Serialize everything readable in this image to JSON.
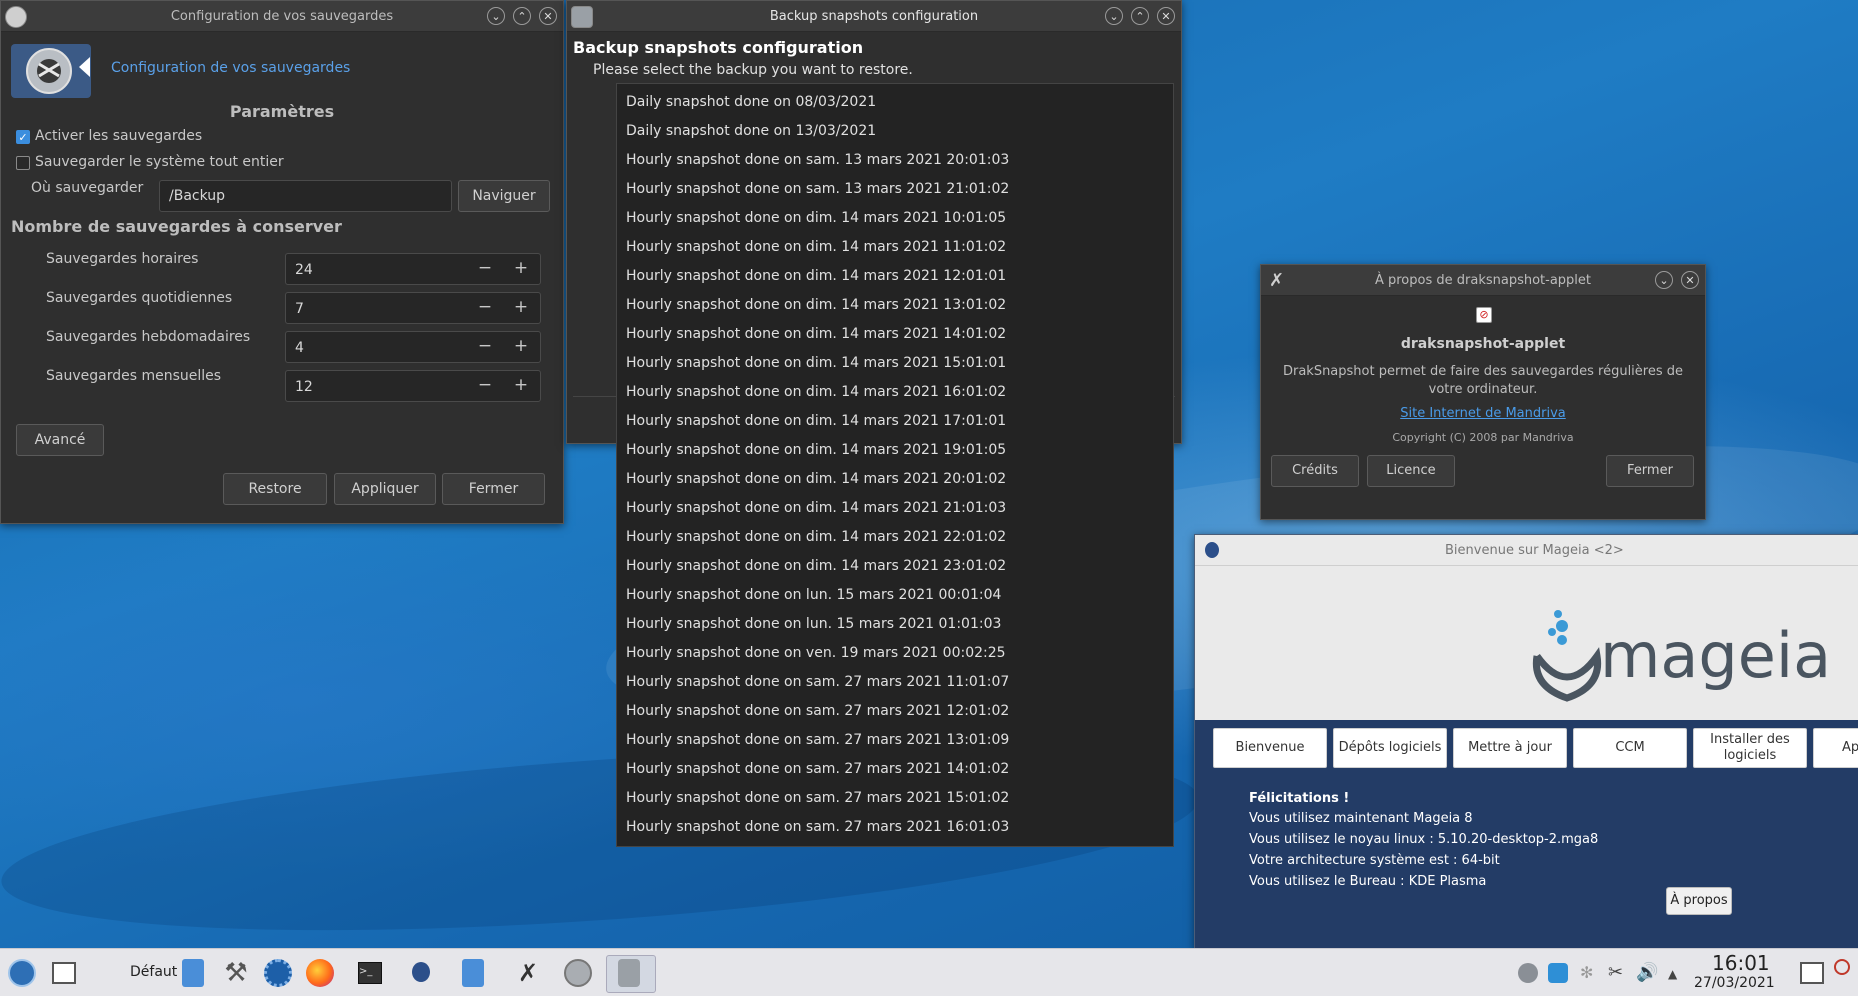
{
  "window_config": {
    "title": "Configuration de vos sauvegardes",
    "header_link": "Configuration de vos sauvegardes",
    "section_params": "Paramètres",
    "enable_label": "Activer les sauvegardes",
    "enable_checked": true,
    "whole_system_label": "Sauvegarder le système tout entier",
    "whole_system_checked": false,
    "where_label": "Où sauvegarder",
    "where_value": "/Backup",
    "browse_label": "Naviguer",
    "section_count": "Nombre de sauvegardes à conserver",
    "spinners": [
      {
        "label": "Sauvegardes horaires",
        "value": "24"
      },
      {
        "label": "Sauvegardes quotidiennes",
        "value": "7"
      },
      {
        "label": "Sauvegardes hebdomadaires",
        "value": "4"
      },
      {
        "label": "Sauvegardes mensuelles",
        "value": "12"
      }
    ],
    "advanced_label": "Avancé",
    "restore_label": "Restore",
    "apply_label": "Appliquer",
    "close_label": "Fermer"
  },
  "window_snapshots": {
    "title": "Backup snapshots configuration",
    "heading": "Backup snapshots configuration",
    "instruction": "Please select the backup you want to restore.",
    "items": [
      "Daily snapshot done on 08/03/2021",
      "Daily snapshot done on 13/03/2021",
      "Hourly snapshot done on sam. 13 mars 2021 20:01:03",
      "Hourly snapshot done on sam. 13 mars 2021 21:01:02",
      "Hourly snapshot done on dim. 14 mars 2021 10:01:05",
      "Hourly snapshot done on dim. 14 mars 2021 11:01:02",
      "Hourly snapshot done on dim. 14 mars 2021 12:01:01",
      "Hourly snapshot done on dim. 14 mars 2021 13:01:02",
      "Hourly snapshot done on dim. 14 mars 2021 14:01:02",
      "Hourly snapshot done on dim. 14 mars 2021 15:01:01",
      "Hourly snapshot done on dim. 14 mars 2021 16:01:02",
      "Hourly snapshot done on dim. 14 mars 2021 17:01:01",
      "Hourly snapshot done on dim. 14 mars 2021 19:01:05",
      "Hourly snapshot done on dim. 14 mars 2021 20:01:02",
      "Hourly snapshot done on dim. 14 mars 2021 21:01:03",
      "Hourly snapshot done on dim. 14 mars 2021 22:01:02",
      "Hourly snapshot done on dim. 14 mars 2021 23:01:02",
      "Hourly snapshot done on lun. 15 mars 2021 00:01:04",
      "Hourly snapshot done on lun. 15 mars 2021 01:01:03",
      "Hourly snapshot done on ven. 19 mars 2021 00:02:25",
      "Hourly snapshot done on sam. 27 mars 2021 11:01:07",
      "Hourly snapshot done on sam. 27 mars 2021 12:01:02",
      "Hourly snapshot done on sam. 27 mars 2021 13:01:09",
      "Hourly snapshot done on sam. 27 mars 2021 14:01:02",
      "Hourly snapshot done on sam. 27 mars 2021 15:01:02",
      "Hourly snapshot done on sam. 27 mars 2021 16:01:03"
    ]
  },
  "window_about": {
    "title": "À propos de draksnapshot-applet",
    "app_name": "draksnapshot-applet",
    "description_line1": "DrakSnapshot permet de faire des sauvegardes régulières de",
    "description_line2": "votre ordinateur.",
    "link": "Site Internet de Mandriva",
    "copyright": "Copyright (C) 2008 par Mandriva",
    "credits_label": "Crédits",
    "license_label": "Licence",
    "close_label": "Fermer"
  },
  "window_mageia": {
    "title": "Bienvenue sur Mageia <2>",
    "logo_text": "mageia",
    "buttons": [
      "Bienvenue",
      "Dépôts logiciels",
      "Mettre à jour",
      "CCM",
      "Installer des logiciels",
      "Appl"
    ],
    "congrats": "Félicitations !",
    "lines": [
      "Vous utilisez maintenant Mageia 8",
      "Vous utilisez le noyau linux : 5.10.20-desktop-2.mga8",
      "Votre architecture système est : 64-bit",
      "Vous utilisez le Bureau : KDE Plasma"
    ],
    "about_label": "À propos"
  },
  "taskbar": {
    "activity_label": "Défaut",
    "time": "16:01",
    "date": "27/03/2021"
  },
  "colors": {
    "accent": "#3b8ede",
    "link": "#5aa0e8",
    "window_bg": "#2f2f2f",
    "mageia_blue": "#233c66"
  }
}
